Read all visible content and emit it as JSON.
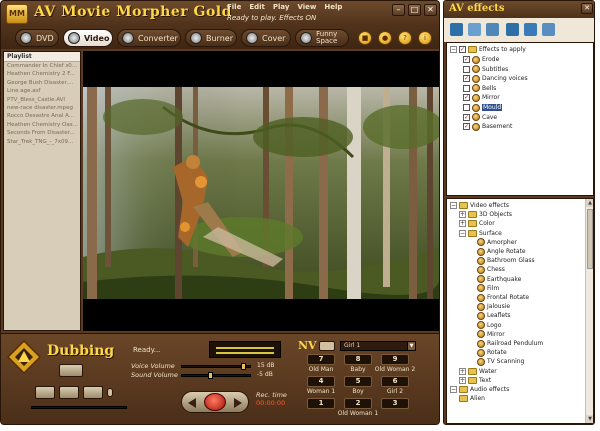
{
  "app": {
    "title": "AV Movie  Morpher Gold",
    "logo_text": "MM",
    "menu": [
      "File",
      "Edit",
      "Play",
      "View",
      "Help"
    ],
    "status": "Ready to play. Effects ON",
    "window_controls": [
      "–",
      "□",
      "✕"
    ]
  },
  "tabs": [
    {
      "label": "DVD",
      "active": false
    },
    {
      "label": "Video",
      "active": true
    },
    {
      "label": "Converter",
      "active": false
    },
    {
      "label": "Burner",
      "active": false
    },
    {
      "label": "Cover",
      "active": false
    },
    {
      "label": "Funny\nSpace",
      "active": false
    }
  ],
  "playlist": {
    "header": "Playlist",
    "items": [
      "Commander In Chief s0...",
      "Heathen Chemistry 2 F...",
      "George Bush Disaster....",
      "Line age.asf",
      "PTV_Bless_Castle.AVI",
      "new-race disaster.mpeg",
      "Rocco Desastre Anal A...",
      "Heathen Chemistry Oas...",
      "Seconds From Disaster...",
      "Star_Trek_TNG_-_7x09..."
    ]
  },
  "dubbing": {
    "title": "Dubbing",
    "status": "Ready...",
    "voice_volume_label": "Voice Volume",
    "voice_volume_value": "15 dB",
    "voice_volume_level": 0.9,
    "sound_volume_label": "Sound Volume",
    "sound_volume_value": "-5 dB",
    "sound_volume_level": 0.4,
    "rec_time_label": "Rec. time",
    "rec_time_value": "00:00:00"
  },
  "nv": {
    "label": "NV",
    "selected": "Girl 1",
    "voices": [
      {
        "key": "7",
        "name": "Old Man"
      },
      {
        "key": "8",
        "name": "Baby"
      },
      {
        "key": "9",
        "name": "Old Woman 2"
      },
      {
        "key": "4",
        "name": "Woman 1"
      },
      {
        "key": "5",
        "name": "Boy"
      },
      {
        "key": "6",
        "name": "Girl 2"
      },
      {
        "key": "1",
        "name": ""
      },
      {
        "key": "2",
        "name": "Old Woman 1"
      },
      {
        "key": "3",
        "name": ""
      }
    ]
  },
  "av_effects": {
    "title": "AV effects",
    "apply_root": "Effects to apply",
    "apply_items": [
      {
        "label": "Erode",
        "checked": true,
        "selected": false
      },
      {
        "label": "Subtitles",
        "checked": false,
        "selected": false
      },
      {
        "label": "Dancing voices",
        "checked": true,
        "selected": false
      },
      {
        "label": "Bells",
        "checked": false,
        "selected": false
      },
      {
        "label": "Mirror",
        "checked": true,
        "selected": false
      },
      {
        "label": "Mould",
        "checked": false,
        "selected": true
      },
      {
        "label": "Cave",
        "checked": true,
        "selected": false
      },
      {
        "label": "Basement",
        "checked": true,
        "selected": false
      }
    ],
    "library_root": "Video effects",
    "library_groups": [
      "3D Objects",
      "Color",
      "Surface"
    ],
    "surface_items": [
      "Amorpher",
      "Angle Rotate",
      "Bathroom Glass",
      "Chess",
      "Earthquake",
      "Film",
      "Frontal Rotate",
      "Jalousie",
      "Leaflets",
      "Logo",
      "Mirror",
      "Railroad Pendulum",
      "Rotate",
      "TV Scanning"
    ],
    "after_groups": [
      "Water",
      "Text"
    ],
    "audio_root": "Audio effects",
    "audio_items": [
      "Alien"
    ]
  },
  "colors": {
    "frame": "#5a3a22",
    "accent_gold": "#ffd84a",
    "rec_red": "#ff5a2a",
    "selection": "#2f4f8f"
  }
}
